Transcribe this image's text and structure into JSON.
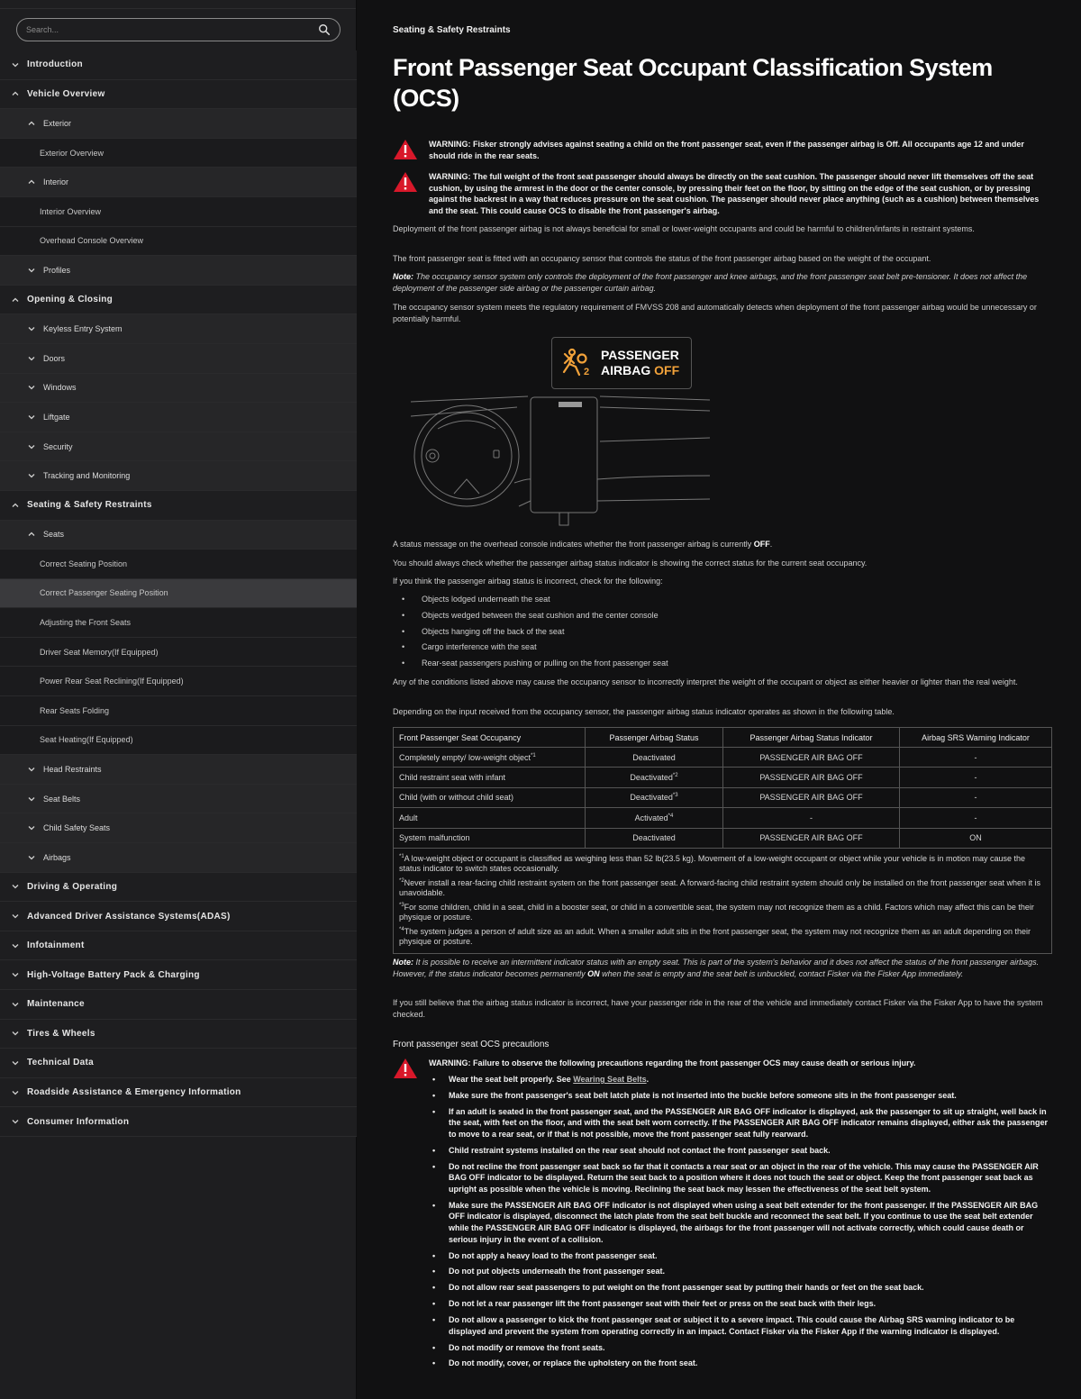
{
  "sidebar": {
    "search_placeholder": "Search...",
    "items": [
      {
        "label": "Introduction",
        "level": 0,
        "expanded": false
      },
      {
        "label": "Vehicle Overview",
        "level": 0,
        "expanded": true
      },
      {
        "label": "Exterior",
        "level": 1,
        "expanded": true
      },
      {
        "label": "Exterior Overview",
        "level": 2
      },
      {
        "label": "Interior",
        "level": 1,
        "expanded": true
      },
      {
        "label": "Interior Overview",
        "level": 2
      },
      {
        "label": "Overhead Console Overview",
        "level": 2
      },
      {
        "label": "Profiles",
        "level": 1,
        "expanded": false
      },
      {
        "label": "Opening & Closing",
        "level": 0,
        "expanded": true
      },
      {
        "label": "Keyless Entry System",
        "level": 1,
        "expanded": false
      },
      {
        "label": "Doors",
        "level": 1,
        "expanded": false
      },
      {
        "label": "Windows",
        "level": 1,
        "expanded": false
      },
      {
        "label": "Liftgate",
        "level": 1,
        "expanded": false
      },
      {
        "label": "Security",
        "level": 1,
        "expanded": false
      },
      {
        "label": "Tracking and Monitoring",
        "level": 1,
        "expanded": false
      },
      {
        "label": "Seating & Safety Restraints",
        "level": 0,
        "expanded": true
      },
      {
        "label": "Seats",
        "level": 1,
        "expanded": true
      },
      {
        "label": "Correct Seating Position",
        "level": 2
      },
      {
        "label": "Correct Passenger Seating Position",
        "level": 2,
        "active": true
      },
      {
        "label": "Adjusting the Front Seats",
        "level": 2
      },
      {
        "label": "Driver Seat Memory(If Equipped)",
        "level": 2
      },
      {
        "label": "Power Rear Seat Reclining(If Equipped)",
        "level": 2
      },
      {
        "label": "Rear Seats Folding",
        "level": 2
      },
      {
        "label": "Seat Heating(If Equipped)",
        "level": 2
      },
      {
        "label": "Head Restraints",
        "level": 1,
        "expanded": false
      },
      {
        "label": "Seat Belts",
        "level": 1,
        "expanded": false
      },
      {
        "label": "Child Safety Seats",
        "level": 1,
        "expanded": false
      },
      {
        "label": "Airbags",
        "level": 1,
        "expanded": false
      },
      {
        "label": "Driving & Operating",
        "level": 0,
        "expanded": false
      },
      {
        "label": "Advanced Driver Assistance Systems(ADAS)",
        "level": 0,
        "expanded": false
      },
      {
        "label": "Infotainment",
        "level": 0,
        "expanded": false
      },
      {
        "label": "High-Voltage Battery Pack & Charging",
        "level": 0,
        "expanded": false
      },
      {
        "label": "Maintenance",
        "level": 0,
        "expanded": false
      },
      {
        "label": "Tires & Wheels",
        "level": 0,
        "expanded": false
      },
      {
        "label": "Technical Data",
        "level": 0,
        "expanded": false
      },
      {
        "label": "Roadside Assistance & Emergency Information",
        "level": 0,
        "expanded": false
      },
      {
        "label": "Consumer Information",
        "level": 0,
        "expanded": false
      }
    ]
  },
  "content": {
    "breadcrumb": "Seating & Safety Restraints",
    "title": "Front Passenger Seat Occupant Classification System (OCS)",
    "warning1": "WARNING: Fisker strongly advises against seating a child on the front passenger seat, even if the passenger airbag is Off. All occupants age 12 and under should ride in the rear seats.",
    "warning2": "WARNING: The full weight of the front seat passenger should always be directly on the seat cushion. The passenger should never lift themselves off the seat cushion, by using the armrest in the door or the center console, by pressing their feet on the floor, by sitting on the edge of the seat cushion, or by pressing against the backrest in a way that reduces pressure on the seat cushion. The passenger should never place anything (such as a cushion) between themselves and the seat. This could cause OCS to disable the front passenger's airbag.",
    "p1": "Deployment of the front passenger airbag is not always beneficial for small or lower-weight occupants and could be harmful to children/infants in restraint systems.",
    "p2": "The front passenger seat is fitted with an occupancy sensor that controls the status of the front passenger airbag based on the weight of the occupant.",
    "note_label": "Note:",
    "note1": "The occupancy sensor system only controls the deployment of the front passenger and knee airbags, and the front passenger seat belt pre-tensioner. It does not affect the deployment of the passenger side airbag or the passenger curtain airbag.",
    "p3": "The occupancy sensor system meets the regulatory requirement of FMVSS 208 and automatically detects when deployment of the front passenger airbag would be unnecessary or potentially harmful.",
    "badge_line1": "PASSENGER",
    "badge_line2a": "AIRBAG",
    "badge_line2b": "OFF",
    "p4a": "A status message on the overhead console indicates whether the front passenger airbag is currently ",
    "p4b": "OFF",
    "p4c": ".",
    "p5": "You should always check whether the passenger airbag status indicator is showing the correct status for the current seat occupancy.",
    "p6": "If you think the passenger airbag status is incorrect, check for the following:",
    "checks": [
      "Objects lodged underneath the seat",
      "Objects wedged between the seat cushion and the center console",
      "Objects hanging off the back of the seat",
      "Cargo interference with the seat",
      "Rear-seat passengers pushing or pulling on the front passenger seat"
    ],
    "p7": "Any of the conditions listed above may cause the occupancy sensor to incorrectly interpret the weight of the occupant or object as either heavier or lighter than the real weight.",
    "p8": "Depending on the input received from the occupancy sensor, the passenger airbag status indicator operates as shown in the following table.",
    "table": {
      "headers": [
        "Front Passenger Seat Occupancy",
        "Passenger Airbag Status",
        "Passenger Airbag Status Indicator",
        "Airbag SRS Warning Indicator"
      ],
      "rows": [
        {
          "c0": "Completely empty/ low-weight object",
          "s0": "*1",
          "c1": "Deactivated",
          "s1": "",
          "c2": "PASSENGER AIR BAG OFF",
          "c3": "-"
        },
        {
          "c0": "Child restraint seat with infant",
          "s0": "",
          "c1": "Deactivated",
          "s1": "*2",
          "c2": "PASSENGER AIR BAG OFF",
          "c3": "-"
        },
        {
          "c0": "Child (with or without child seat)",
          "s0": "",
          "c1": "Deactivated",
          "s1": "*3",
          "c2": "PASSENGER AIR BAG OFF",
          "c3": "-"
        },
        {
          "c0": "Adult",
          "s0": "",
          "c1": "Activated",
          "s1": "*4",
          "c2": "-",
          "c3": "-"
        },
        {
          "c0": "System malfunction",
          "s0": "",
          "c1": "Deactivated",
          "s1": "",
          "c2": "PASSENGER AIR BAG OFF",
          "c3": "ON"
        }
      ],
      "footnotes": [
        {
          "mark": "*1",
          "text": "A low-weight object or occupant is classified as weighing less than 52 lb(23.5 kg). Movement of a low-weight occupant or object while your vehicle is in motion may cause the status indicator to switch states occasionally."
        },
        {
          "mark": "*2",
          "text": "Never install a rear-facing child restraint system on the front passenger seat. A forward-facing child restraint system should only be installed on the front passenger seat when it is unavoidable."
        },
        {
          "mark": "*3",
          "text": "For some children, child in a seat, child in a booster seat, or child in a convertible seat, the system may not recognize them as a child. Factors which may affect this can be their physique or posture."
        },
        {
          "mark": "*4",
          "text": "The system judges a person of adult size as an adult. When a smaller adult sits in the front passenger seat, the system may not recognize them as an adult depending on their physique or posture."
        }
      ]
    },
    "note2a": "It is possible to receive an intermittent indicator status with an empty seat. This is part of the system's behavior and it does not affect the status of the front passenger airbags. However, if the status indicator becomes permanently ",
    "note2b": "ON",
    "note2c": " when the seat is empty and the seat belt is unbuckled, contact Fisker via the Fisker App immediately.",
    "p9": "If you still believe that the airbag status indicator is incorrect, have your passenger ride in the rear of the vehicle and immediately contact Fisker via the Fisker App to have the system checked.",
    "subhead": "Front passenger seat OCS precautions",
    "warning3": "WARNING: Failure to observe the following precautions regarding the front passenger OCS may cause death or serious injury.",
    "precaution_first_a": "Wear the seat belt properly. See ",
    "precaution_first_link": "Wearing Seat Belts",
    "precaution_first_c": ".",
    "precautions": [
      "Make sure the front passenger's seat belt latch plate is not inserted into the buckle before someone sits in the front passenger seat.",
      "If an adult is seated in the front passenger seat, and the PASSENGER AIR BAG OFF indicator is displayed, ask the passenger to sit up straight, well back in the seat, with feet on the floor, and with the seat belt worn correctly. If the PASSENGER AIR BAG OFF indicator remains displayed, either ask the passenger to move to a rear seat, or if that is not possible, move the front passenger seat fully rearward.",
      "Child restraint systems installed on the rear seat should not contact the front passenger seat back.",
      "Do not recline the front passenger seat back so far that it contacts a rear seat or an object in the rear of the vehicle. This may cause the PASSENGER AIR BAG OFF indicator to be displayed. Return the seat back to a position where it does not touch the seat or object. Keep the front passenger seat back as upright as possible when the vehicle is moving. Reclining the seat back may lessen the effectiveness of the seat belt system.",
      "Make sure the PASSENGER AIR BAG OFF indicator is not displayed when using a seat belt extender for the front passenger. If the PASSENGER AIR BAG OFF indicator is displayed, disconnect the latch plate from the seat belt buckle and reconnect the seat belt. If you continue to use the seat belt extender while the PASSENGER AIR BAG OFF indicator is displayed, the airbags for the front passenger will not activate correctly, which could cause death or serious injury in the event of a collision.",
      "Do not apply a heavy load to the front passenger seat.",
      "Do not put objects underneath the front passenger seat.",
      "Do not allow rear seat passengers to put weight on the front passenger seat by putting their hands or feet on the seat back.",
      "Do not let a rear passenger lift the front passenger seat with their feet or press on the seat back with their legs.",
      "Do not allow a passenger to kick the front passenger seat or subject it to a severe impact. This could cause the Airbag SRS warning indicator to be displayed and prevent the system from operating correctly in an impact. Contact Fisker via the Fisker App if the warning indicator is displayed.",
      "Do not modify or remove the front seats.",
      "Do not modify, cover, or replace the upholstery on the front seat."
    ]
  },
  "colors": {
    "warning_red": "#d8182a",
    "airbag_off_orange": "#f2a23a",
    "sidebar_bg": "#1e1e20",
    "content_bg": "#111112"
  },
  "icons": [
    "search-icon",
    "chevron-down-icon",
    "chevron-up-icon",
    "warning-triangle-icon",
    "airbag-off-icon"
  ]
}
